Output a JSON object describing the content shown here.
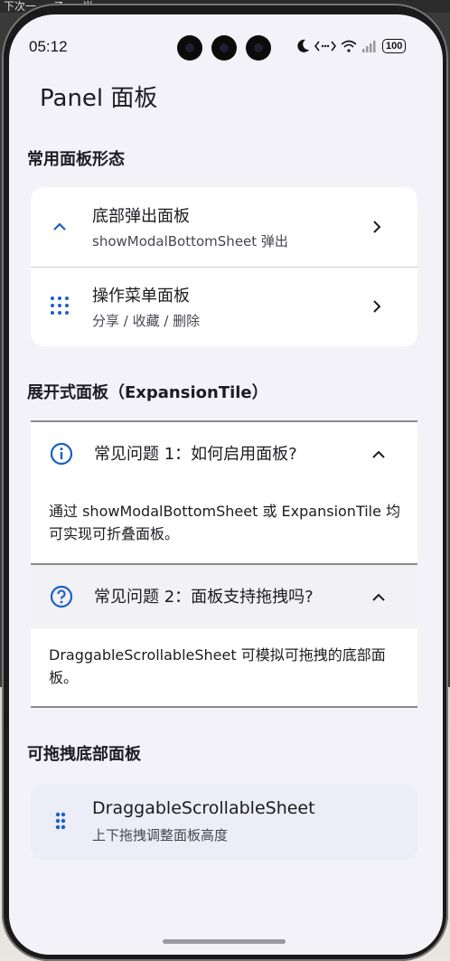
{
  "top_strip": {
    "text": "下次一 … 乙  … 当    … … …"
  },
  "status_bar": {
    "time": "05:12",
    "battery": "100",
    "icons": [
      "moon-icon",
      "data-arrows-icon",
      "wifi-icon",
      "signal-icon",
      "battery-icon"
    ]
  },
  "app_bar": {
    "title": "Panel 面板"
  },
  "section1": {
    "title": "常用面板形态",
    "items": [
      {
        "title": "底部弹出面板",
        "subtitle": "showModalBottomSheet 弹出",
        "icon": "chevron-up-icon"
      },
      {
        "title": "操作菜单面板",
        "subtitle": "分享 / 收藏 / 删除",
        "icon": "apps-grid-icon"
      }
    ]
  },
  "section2": {
    "title": "展开式面板（ExpansionTile）",
    "tiles": [
      {
        "question": "常见问题 1：如何启用面板?",
        "answer": "通过 showModalBottomSheet 或 ExpansionTile 均可实现可折叠面板。",
        "icon": "info-icon"
      },
      {
        "question": "常见问题 2：面板支持拖拽吗?",
        "answer": "DraggableScrollableSheet 可模拟可拖拽的底部面板。",
        "icon": "help-icon"
      }
    ]
  },
  "section3": {
    "title": "可拖拽底部面板",
    "item": {
      "title": "DraggableScrollableSheet",
      "subtitle": "上下拖拽调整面板高度",
      "icon": "drag-handle-icon"
    }
  },
  "colors": {
    "accent": "#1a5fc8",
    "background": "#f3f2f8",
    "card": "#ffffff",
    "highlight": "#f2f1f4"
  }
}
